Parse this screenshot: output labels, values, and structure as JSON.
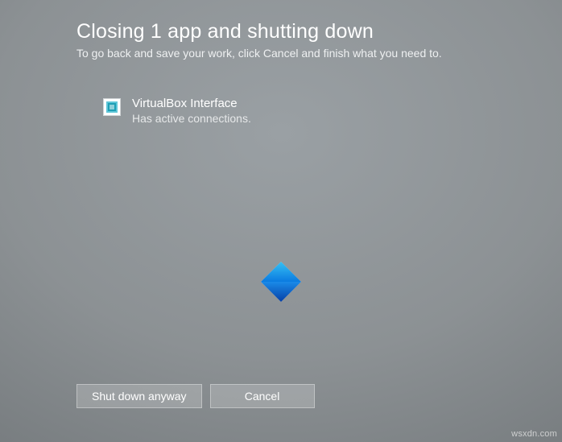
{
  "header": {
    "title": "Closing 1 app and shutting down",
    "subtitle": "To go back and save your work, click Cancel and finish what you need to."
  },
  "apps": [
    {
      "name": "VirtualBox Interface",
      "status": "Has active connections.",
      "icon": "virtualbox-icon"
    }
  ],
  "buttons": {
    "shutdown": "Shut down anyway",
    "cancel": "Cancel"
  },
  "watermark": "wsxdn.com",
  "colors": {
    "logo_top": "#2fb7f0",
    "logo_bottom": "#0a5bd6"
  }
}
